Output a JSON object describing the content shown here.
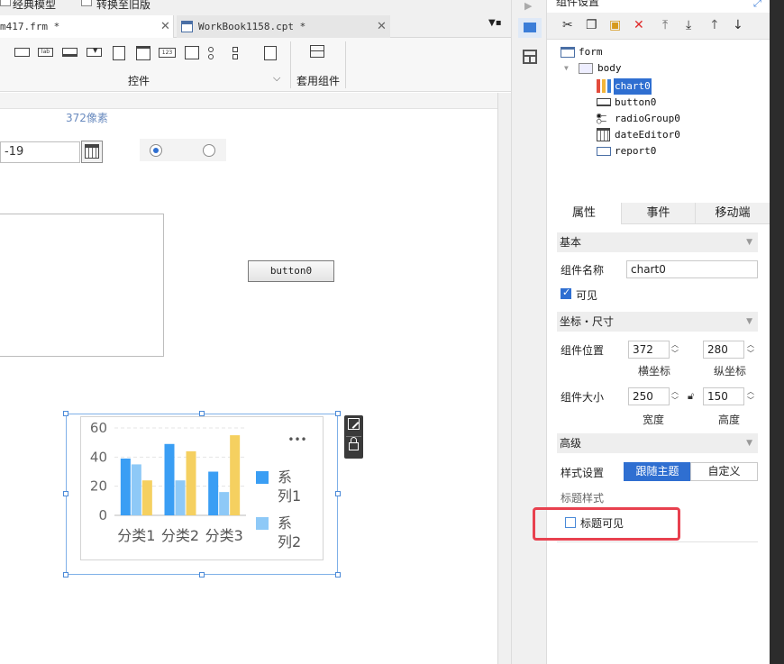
{
  "top_strip": {
    "item1": "经典模型",
    "item2": "转换至旧版"
  },
  "tabs": [
    {
      "label": "m417.frm *",
      "active": true
    },
    {
      "label": "WorkBook1158.cpt *",
      "active": false
    }
  ],
  "toolbar": {
    "group_label": "控件",
    "group2_label": "套用组件"
  },
  "canvas": {
    "guide_label": "372像素",
    "date_value": "-19",
    "button_label": "button0"
  },
  "chart_data": {
    "type": "bar",
    "categories": [
      "分类1",
      "分类2",
      "分类3"
    ],
    "series": [
      {
        "name": "系列1",
        "values": [
          39,
          49,
          30
        ],
        "color": "#3a9ef4"
      },
      {
        "name": "系列2",
        "values": [
          35,
          24,
          16
        ],
        "color": "#8ec9f7"
      },
      {
        "name": "",
        "values": [
          24,
          44,
          55
        ],
        "color": "#f5d060"
      }
    ],
    "yticks": [
      "0",
      "20",
      "40",
      "60"
    ],
    "ylim": [
      0,
      60
    ],
    "legend_position": "right",
    "legend_lines": [
      [
        "系",
        "列1"
      ],
      [
        "系",
        "列2"
      ]
    ],
    "more_glyph": "•••"
  },
  "right_panel": {
    "title": "组件设置",
    "tree": {
      "form": "form",
      "body": "body",
      "items": [
        "chart0",
        "button0",
        "radioGroup0",
        "dateEditor0",
        "report0"
      ]
    },
    "tabs": [
      "属性",
      "事件",
      "移动端"
    ],
    "sections": {
      "basic": "基本",
      "coords": "坐标・尺寸",
      "advanced": "高级"
    },
    "component_name_label": "组件名称",
    "component_name_value": "chart0",
    "visible_label": "可见",
    "position_label": "组件位置",
    "pos_x": "372",
    "pos_y": "280",
    "x_label": "横坐标",
    "y_label": "纵坐标",
    "size_label": "组件大小",
    "width": "250",
    "height": "150",
    "width_label": "宽度",
    "height_label": "高度",
    "style_label": "样式设置",
    "style_options": [
      "跟随主题",
      "自定义"
    ],
    "title_style_label": "标题样式",
    "title_visible_label": "标题可见"
  }
}
